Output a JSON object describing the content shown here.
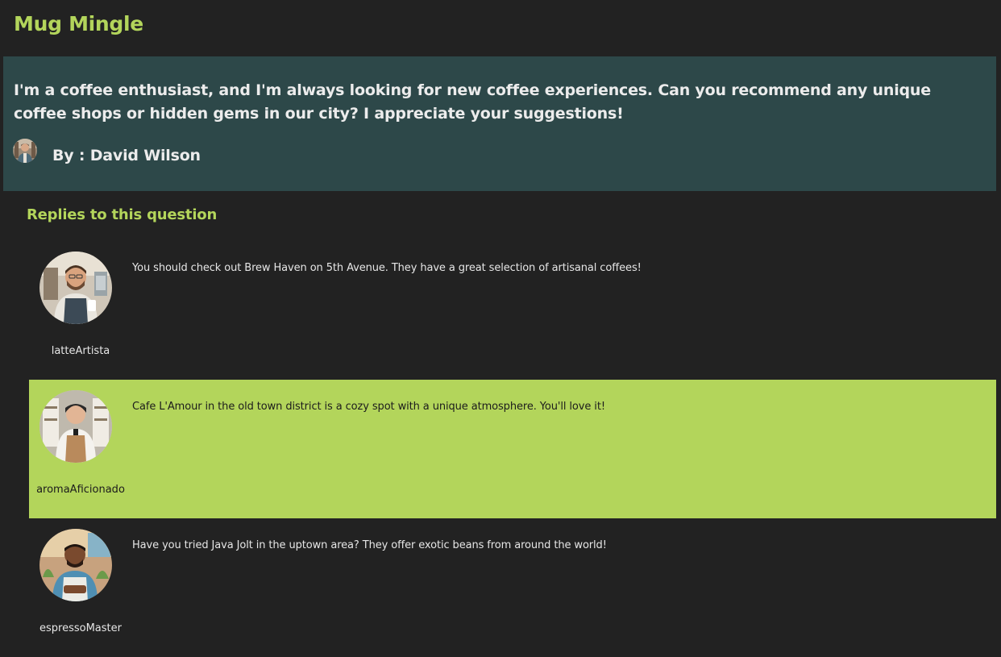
{
  "app": {
    "title": "Mug Mingle"
  },
  "question": {
    "text": "I'm a coffee enthusiast, and I'm always looking for new coffee experiences. Can you recommend any unique coffee shops or hidden gems in our city? I appreciate your suggestions!",
    "author_label": "By : David Wilson",
    "avatar_icon": "user-avatar-photo"
  },
  "replies_section": {
    "heading": "Replies to this question"
  },
  "replies": [
    {
      "text": "You should check out Brew Haven on 5th Avenue. They have a great selection of artisanal coffees!",
      "username": "latteArtista",
      "highlighted": false,
      "avatar_icon": "barista-avatar-photo"
    },
    {
      "text": "Cafe L'Amour in the old town district is a cozy spot with a unique atmosphere. You'll love it!",
      "username": "aromaAficionado",
      "highlighted": true,
      "avatar_icon": "barista-avatar-photo"
    },
    {
      "text": "Have you tried Java Jolt in the uptown area? They offer exotic beans from around the world!",
      "username": "espressoMaster",
      "highlighted": false,
      "avatar_icon": "barista-avatar-photo"
    }
  ],
  "colors": {
    "accent": "#b3d55b",
    "background": "#222222",
    "question_panel": "#2d4849",
    "text_light": "#e6e6e6"
  }
}
